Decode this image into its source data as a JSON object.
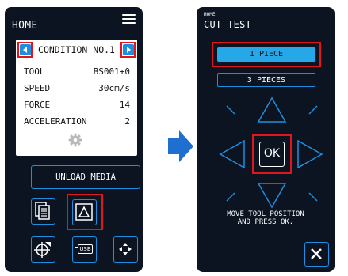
{
  "left_screen": {
    "header": "HOME",
    "condition": {
      "title": "CONDITION NO.1",
      "rows": [
        {
          "key": "TOOL",
          "value": "BS001+0"
        },
        {
          "key": "SPEED",
          "value": "30cm/s"
        },
        {
          "key": "FORCE",
          "value": "14"
        },
        {
          "key": "ACCELERATION",
          "value": "2"
        }
      ]
    },
    "unload_label": "UNLOAD MEDIA",
    "usb_label": "USB"
  },
  "right_screen": {
    "breadcrumb": "HOME",
    "title": "CUT TEST",
    "one_piece": "1 PIECE",
    "three_pieces": "3 PIECES",
    "ok_label": "OK",
    "message_line1": "MOVE TOOL POSITION",
    "message_line2": "AND PRESS OK."
  },
  "colors": {
    "screen_bg": "#0b1420",
    "accent_blue": "#1e8fe0",
    "highlight_red": "#e0161b",
    "active_pill": "#25a7e8"
  }
}
